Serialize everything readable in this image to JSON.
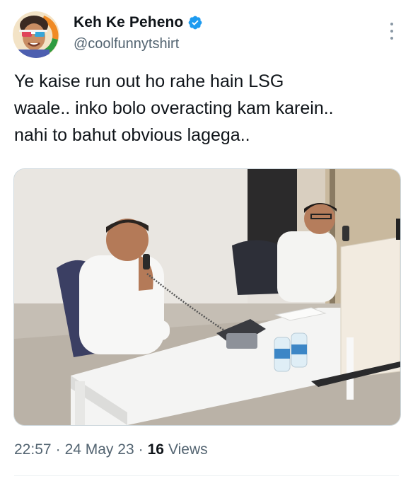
{
  "author": {
    "display_name": "Keh Ke Peheno",
    "handle": "@coolfunnytshirt",
    "verified_icon": "verified-badge-icon",
    "verified_color": "#1d9bf0"
  },
  "tweet": {
    "lines": [
      "Ye kaise run out ho rahe hain LSG",
      "waale.. inko bolo overacting kam karein..",
      "nahi to bahut obvious lagega.."
    ]
  },
  "meta": {
    "time": "22:57",
    "separator": "·",
    "date": "24 May 23",
    "views_count": "16",
    "views_label": "Views"
  },
  "colors": {
    "text_primary": "#0f1419",
    "text_secondary": "#536471",
    "accent": "#1d9bf0"
  }
}
